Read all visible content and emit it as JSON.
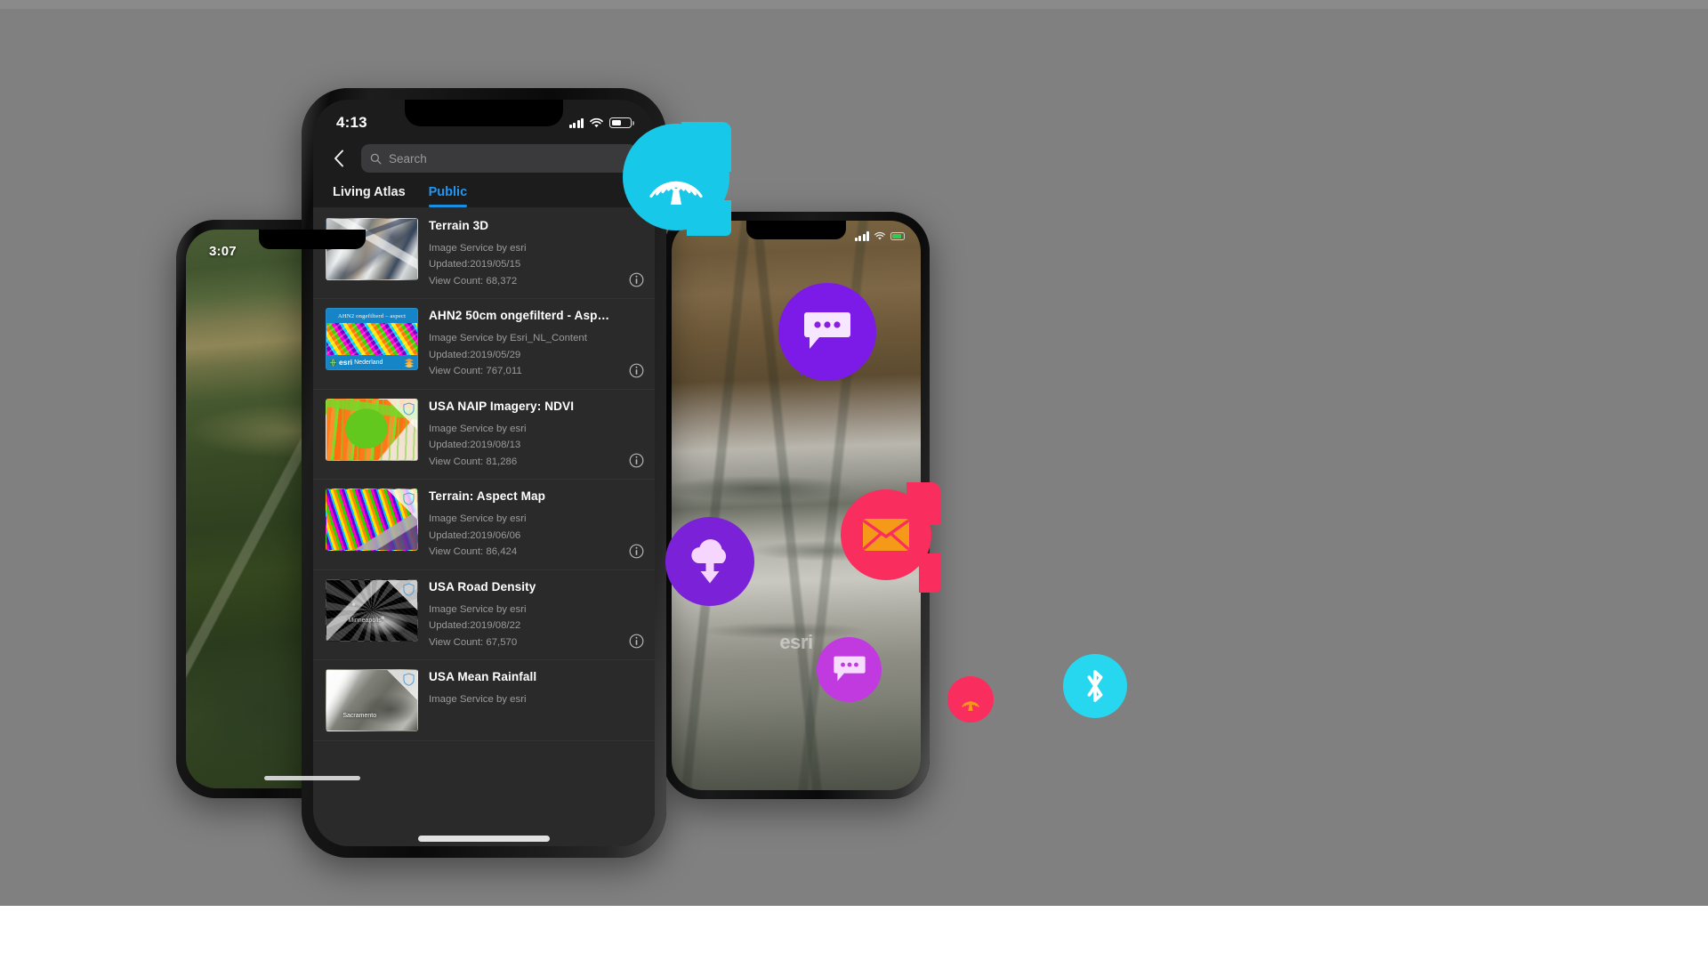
{
  "scene": {
    "background_color": "#808080",
    "accent_blue": "#2196f3"
  },
  "phone_left": {
    "name": "background-phone-left",
    "status_time": "3:07",
    "map_description": "aerial-imagery-green-fields"
  },
  "phone_right": {
    "name": "background-phone-right",
    "watermark": "esri",
    "map_description": "aerial-imagery-mountain-snow"
  },
  "phone_main": {
    "status": {
      "time": "4:13",
      "signal_icon": "cellular-bars-icon",
      "wifi_icon": "wifi-icon",
      "battery_icon": "battery-icon"
    },
    "nav": {
      "back_icon": "chevron-left-icon"
    },
    "search": {
      "icon": "search-icon",
      "placeholder": "Search",
      "value": ""
    },
    "tabs": [
      {
        "label": "Living Atlas",
        "active": false
      },
      {
        "label": "Public",
        "active": true
      }
    ],
    "info_icon": "info-circle-icon",
    "shield_icon": "shield-icon",
    "list": [
      {
        "title": "Terrain 3D",
        "service": "Image Service by esri",
        "updated": "Updated:2019/05/15",
        "views": "View Count: 68,372",
        "thumb": "terrain-3d-thumbnail"
      },
      {
        "title": "AHN2 50cm ongefilterd - Asp…",
        "service": "Image Service by Esri_NL_Content",
        "updated": "Updated:2019/05/29",
        "views": "View Count: 767,011",
        "thumb": "ahn2-aspect-thumbnail",
        "thumb_header": "AHN2 ongefilterd – aspect",
        "thumb_footer_brand": "esri",
        "thumb_footer_text": "Nederland"
      },
      {
        "title": "USA NAIP Imagery: NDVI",
        "service": "Image Service by esri",
        "updated": "Updated:2019/08/13",
        "views": "View Count: 81,286",
        "thumb": "naip-ndvi-thumbnail"
      },
      {
        "title": "Terrain: Aspect Map",
        "service": "Image Service by esri",
        "updated": "Updated:2019/06/06",
        "views": "View Count: 86,424",
        "thumb": "terrain-aspect-thumbnail"
      },
      {
        "title": "USA Road Density",
        "service": "Image Service by esri",
        "updated": "Updated:2019/08/22",
        "views": "View Count: 67,570",
        "thumb": "road-density-thumbnail",
        "thumb_label_1": "Minneapolis"
      },
      {
        "title": "USA Mean Rainfall",
        "service": "Image Service by esri",
        "updated": "",
        "views": "",
        "thumb": "mean-rainfall-thumbnail",
        "thumb_label_1": "Sacramento"
      }
    ]
  },
  "badges": [
    {
      "name": "broadcast-badge-cyan",
      "icon": "broadcast-icon",
      "color": "#18c8e8"
    },
    {
      "name": "chat-badge-violet",
      "icon": "chat-bubble-icon",
      "color": "#7c1ae8"
    },
    {
      "name": "mail-badge",
      "icon": "envelope-icon",
      "color": "#fa2e5e"
    },
    {
      "name": "cloud-download-badge",
      "icon": "cloud-download-icon",
      "color": "#7b22d8"
    },
    {
      "name": "chat-badge-small",
      "icon": "chat-bubble-icon",
      "color": "#c03ae0"
    },
    {
      "name": "broadcast-badge-small",
      "icon": "broadcast-icon",
      "color": "#fa2e5e"
    },
    {
      "name": "bluetooth-badge",
      "icon": "bluetooth-icon",
      "color": "#27d7f0"
    }
  ]
}
